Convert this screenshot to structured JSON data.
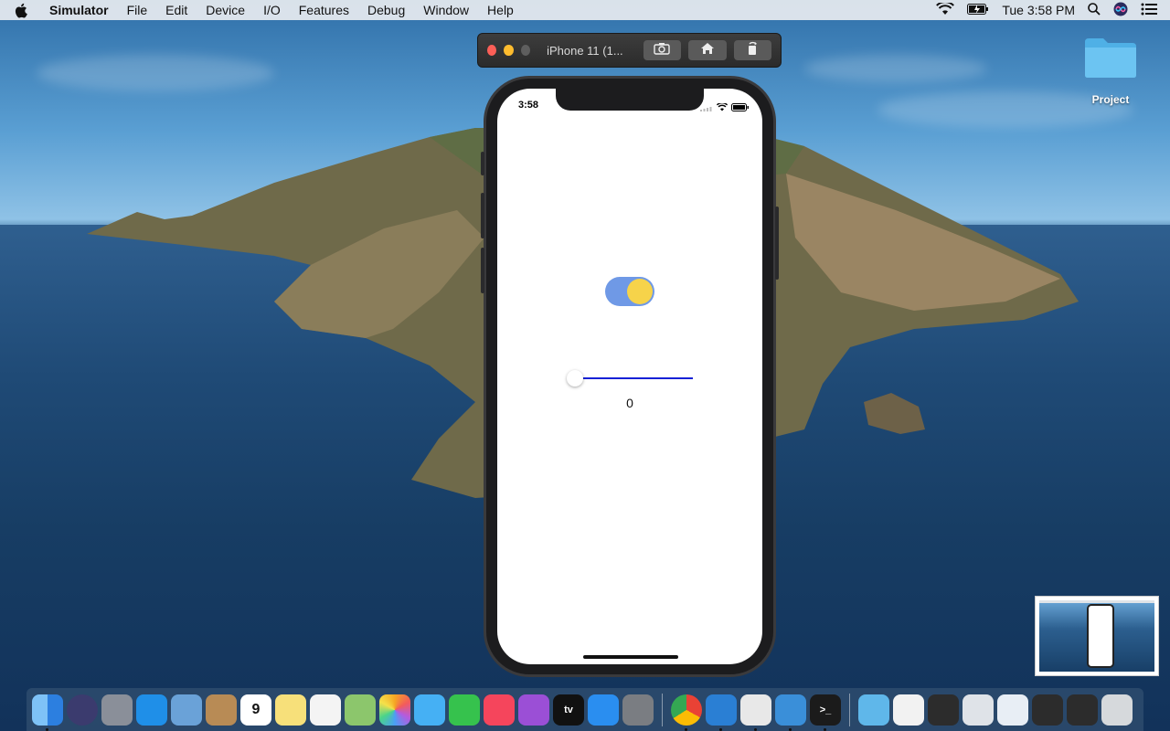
{
  "menubar": {
    "app_name": "Simulator",
    "items": [
      "File",
      "Edit",
      "Device",
      "I/O",
      "Features",
      "Debug",
      "Window",
      "Help"
    ],
    "clock": "Tue 3:58 PM"
  },
  "simulator": {
    "window_title": "iPhone 11 (1...",
    "buttons": [
      "screenshot-icon",
      "home-icon",
      "rotate-icon"
    ]
  },
  "phone": {
    "status_time": "3:58",
    "toggle": {
      "on": true,
      "track_color": "#6f99e6",
      "knob_color": "#f6d34a"
    },
    "slider": {
      "value": 0,
      "track_color": "#1621d6",
      "value_label": "0"
    }
  },
  "desktop": {
    "folder_label": "Project"
  },
  "dock": {
    "apps": [
      {
        "name": "finder",
        "color": "#3c8ef0",
        "running": true
      },
      {
        "name": "siri",
        "color": "#3b3b6e",
        "running": false
      },
      {
        "name": "launchpad",
        "color": "#8a8f99",
        "running": false
      },
      {
        "name": "safari",
        "color": "#1f8fe8",
        "running": false
      },
      {
        "name": "mail-bird",
        "color": "#6aa2d8",
        "running": false
      },
      {
        "name": "contacts",
        "color": "#b88b55",
        "running": false
      },
      {
        "name": "calendar",
        "color": "#ffffff",
        "label": "9",
        "running": false
      },
      {
        "name": "notes",
        "color": "#f7e07a",
        "running": false
      },
      {
        "name": "reminders",
        "color": "#f4f4f4",
        "running": false
      },
      {
        "name": "maps",
        "color": "#8cc66c",
        "running": false
      },
      {
        "name": "photos",
        "color": "#f3a23a",
        "running": false
      },
      {
        "name": "messages",
        "color": "#45b0f4",
        "running": false
      },
      {
        "name": "facetime",
        "color": "#36c24d",
        "running": false
      },
      {
        "name": "music",
        "color": "#f5455c",
        "running": false
      },
      {
        "name": "podcasts",
        "color": "#9b4fd6",
        "running": false
      },
      {
        "name": "apple-tv",
        "color": "#111111",
        "label": "tv",
        "running": false
      },
      {
        "name": "app-store",
        "color": "#2a8ef0",
        "running": false
      },
      {
        "name": "system-preferences",
        "color": "#7a7d82",
        "running": false
      }
    ],
    "apps_right": [
      {
        "name": "chrome",
        "color": "#e9ecef",
        "running": true
      },
      {
        "name": "vscode",
        "color": "#2a7fd4",
        "running": true
      },
      {
        "name": "textedit",
        "color": "#e8e8e8",
        "running": true
      },
      {
        "name": "xcode",
        "color": "#3a8fd9",
        "running": true
      },
      {
        "name": "terminal",
        "color": "#1b1b1b",
        "label": ">_",
        "running": true
      }
    ],
    "stack": [
      {
        "name": "folder-stack",
        "color": "#5fb7ea"
      },
      {
        "name": "document",
        "color": "#f2f2f2"
      },
      {
        "name": "window-thumb-1",
        "color": "#2c2c2c"
      },
      {
        "name": "window-thumb-2",
        "color": "#dfe3e8"
      },
      {
        "name": "window-thumb-3",
        "color": "#e8eef5"
      },
      {
        "name": "window-thumb-4",
        "color": "#2c2c2c"
      },
      {
        "name": "window-thumb-5",
        "color": "#2c2c2c"
      },
      {
        "name": "trash",
        "color": "#d6d9dc"
      }
    ]
  }
}
